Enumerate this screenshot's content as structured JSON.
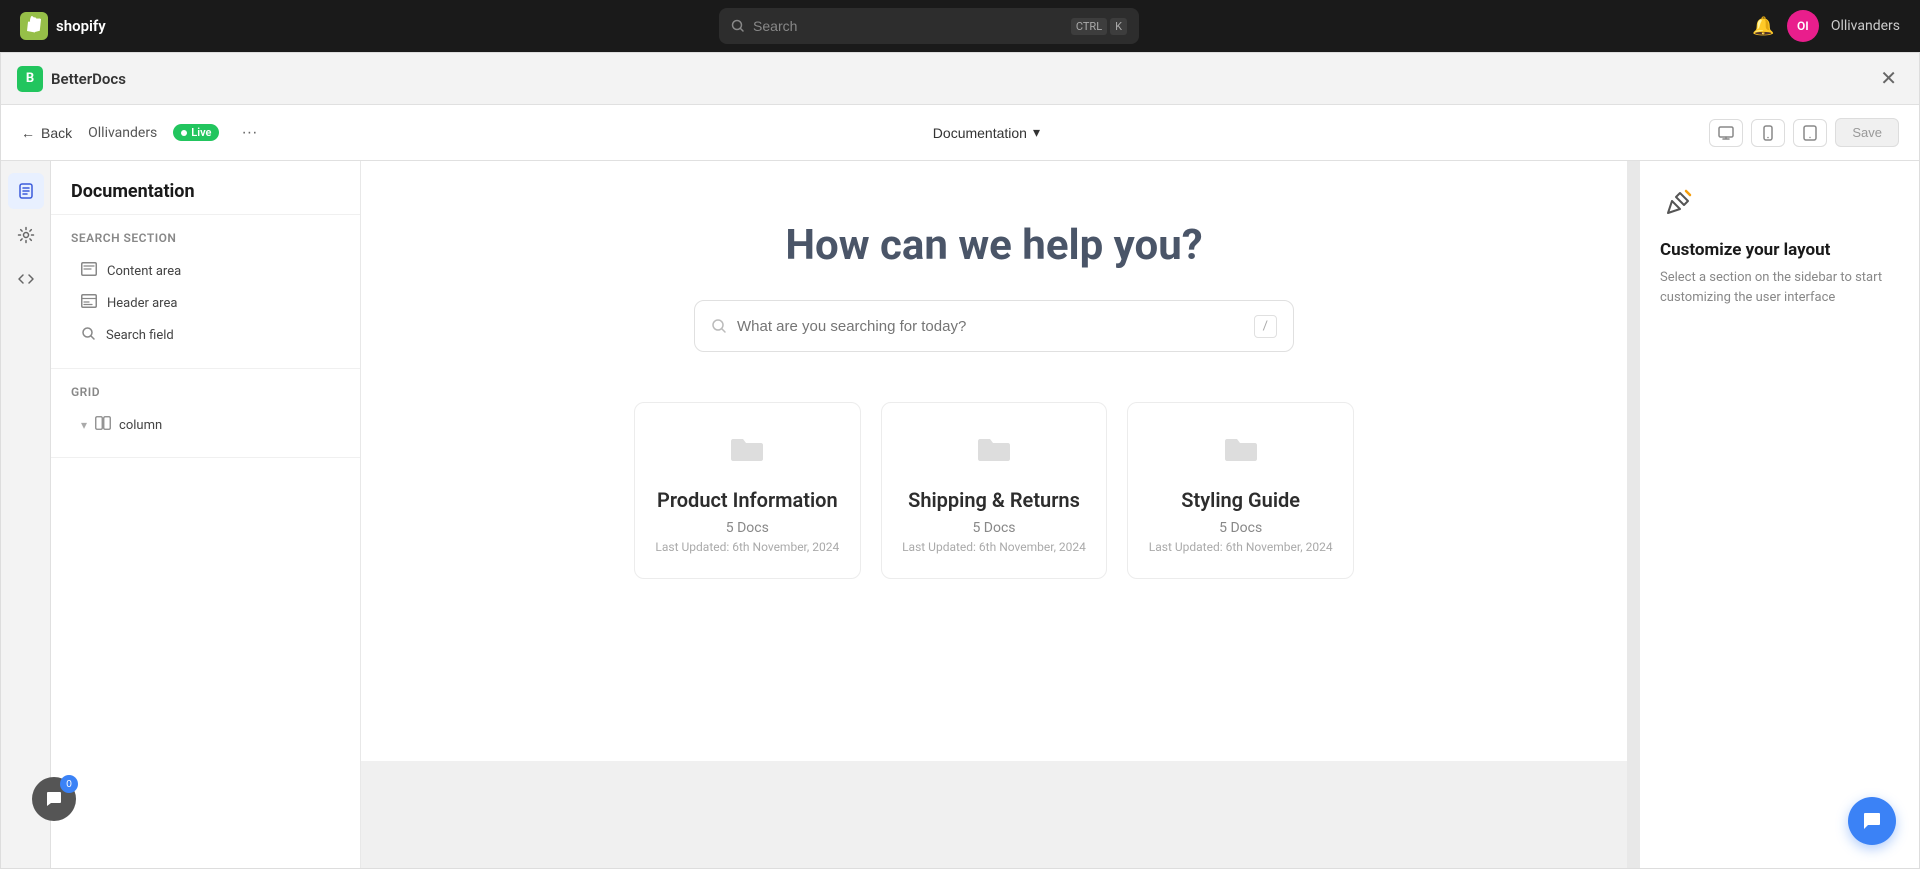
{
  "shopify": {
    "logo_text": "shopify",
    "search_placeholder": "Search",
    "search_shortcut_ctrl": "CTRL",
    "search_shortcut_k": "K",
    "user_initials": "OI",
    "user_name": "Ollivanders"
  },
  "app": {
    "logo_letter": "B",
    "title": "BetterDocs",
    "close_label": "✕"
  },
  "editor_header": {
    "back_label": "Back",
    "store_name": "Ollivanders",
    "live_label": "Live",
    "more_label": "···",
    "doc_dropdown_label": "Documentation",
    "save_label": "Save"
  },
  "left_panel": {
    "title": "Documentation",
    "search_section_label": "Search section",
    "items": [
      {
        "label": "Content area",
        "icon": "▭"
      },
      {
        "label": "Header area",
        "icon": "▤"
      },
      {
        "label": "Search field",
        "icon": "🔍"
      }
    ],
    "grid_label": "Grid",
    "column_label": "column"
  },
  "preview": {
    "hero_title": "How can we help you?",
    "search_placeholder": "What are you searching for today?",
    "slash_hint": "/",
    "doc_cards": [
      {
        "title": "Product Information",
        "count": "5 Docs",
        "updated": "Last Updated: 6th November, 2024"
      },
      {
        "title": "Shipping & Returns",
        "count": "5 Docs",
        "updated": "Last Updated: 6th November, 2024"
      },
      {
        "title": "Styling Guide",
        "count": "5 Docs",
        "updated": "Last Updated: 6th November, 2024"
      }
    ]
  },
  "right_panel": {
    "title": "Customize your layout",
    "description": "Select a section on the sidebar to start customizing the user interface"
  },
  "chat": {
    "badge_count": "0"
  },
  "icons": {
    "pages": "📄",
    "settings": "⚙",
    "code": "</>",
    "desktop": "🖥",
    "mobile": "📱",
    "tablet": "⊡",
    "folder": "📁"
  }
}
